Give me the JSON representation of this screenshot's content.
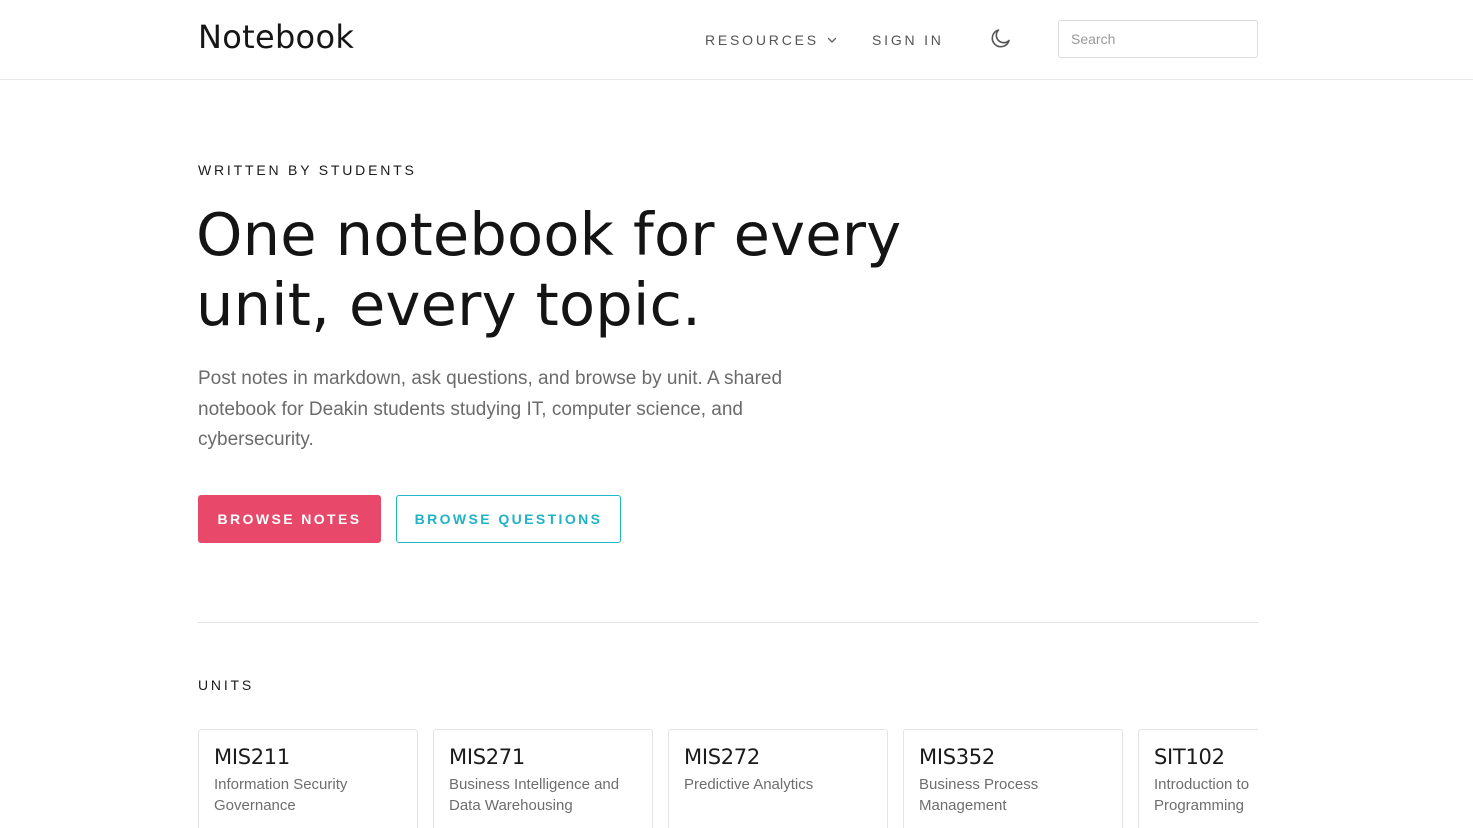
{
  "header": {
    "brand": "Notebook",
    "nav": {
      "resources_label": "RESOURCES",
      "signin_label": "SIGN IN"
    },
    "theme_icon": "moon-icon",
    "search": {
      "placeholder": "Search",
      "value": ""
    }
  },
  "hero": {
    "eyebrow": "WRITTEN BY STUDENTS",
    "title_line1": "One notebook for every",
    "title_line2": "unit, every topic.",
    "subtitle": "Post notes in markdown, ask questions, and browse by unit. A shared notebook for Deakin students studying IT, computer science, and cybersecurity.",
    "primary_button": "BROWSE NOTES",
    "secondary_button": "BROWSE QUESTIONS"
  },
  "units": {
    "heading": "UNITS",
    "items": [
      {
        "code": "MIS211",
        "name": "Information Security Governance"
      },
      {
        "code": "MIS271",
        "name": "Business Intelligence and Data Warehousing"
      },
      {
        "code": "MIS272",
        "name": "Predictive Analytics"
      },
      {
        "code": "MIS352",
        "name": "Business Process Management"
      },
      {
        "code": "SIT102",
        "name": "Introduction to Programming"
      }
    ]
  },
  "colors": {
    "primary": "#e8496a",
    "secondary": "#1fb3c4",
    "text": "#141414",
    "muted": "#6b6b6b"
  }
}
